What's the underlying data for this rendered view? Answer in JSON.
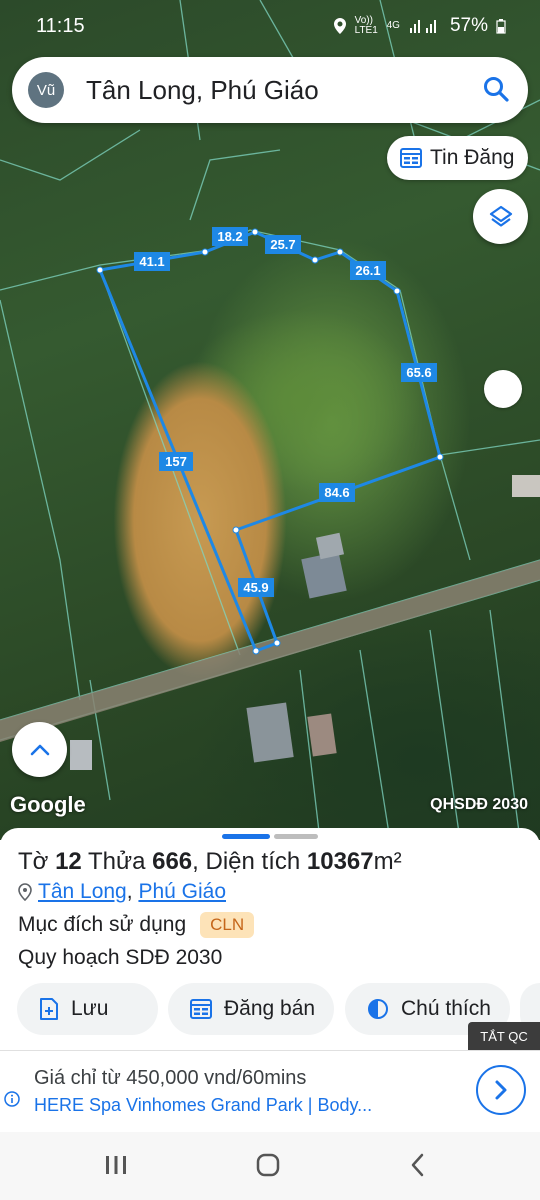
{
  "status": {
    "time": "11:15",
    "volte": "Vo)) LTE1",
    "network": "4G",
    "battery": "57%"
  },
  "search": {
    "avatar_letter": "Vũ",
    "text": "Tân Long, Phú Giáo"
  },
  "map": {
    "chip_label": "Tin Đăng",
    "google_logo": "Google",
    "overlay_tag": "QHSDĐ 2030",
    "edge_labels": [
      "41.1",
      "18.2",
      "25.7",
      "26.1",
      "65.6",
      "157",
      "84.6",
      "45.9"
    ]
  },
  "parcel": {
    "to_label": "Tờ",
    "to_value": "12",
    "thua_label": "Thửa",
    "thua_value": "666",
    "area_label": ", Diện tích",
    "area_value": "10367",
    "area_unit": "m²",
    "ward": "Tân Long",
    "district": "Phú Giáo",
    "separator": ",",
    "purpose_label": "Mục đích sử dụng",
    "purpose_code": "CLN",
    "plan_label": "Quy hoạch SDĐ 2030"
  },
  "actions": [
    {
      "label": "Lưu",
      "icon": "save-add-icon"
    },
    {
      "label": "Đăng bán",
      "icon": "listing-icon"
    },
    {
      "label": "Chú thích",
      "icon": "legend-icon"
    }
  ],
  "ad": {
    "close_label": "TẮT QC",
    "title": "Giá chỉ từ 450,000 vnd/60mins",
    "subtitle": "HERE Spa Vinhomes Grand Park | Body..."
  },
  "colors": {
    "accent": "#1a73e8",
    "boundary": "#1e88e5",
    "badge_bg": "#fde3b8",
    "badge_text": "#c5661a"
  }
}
